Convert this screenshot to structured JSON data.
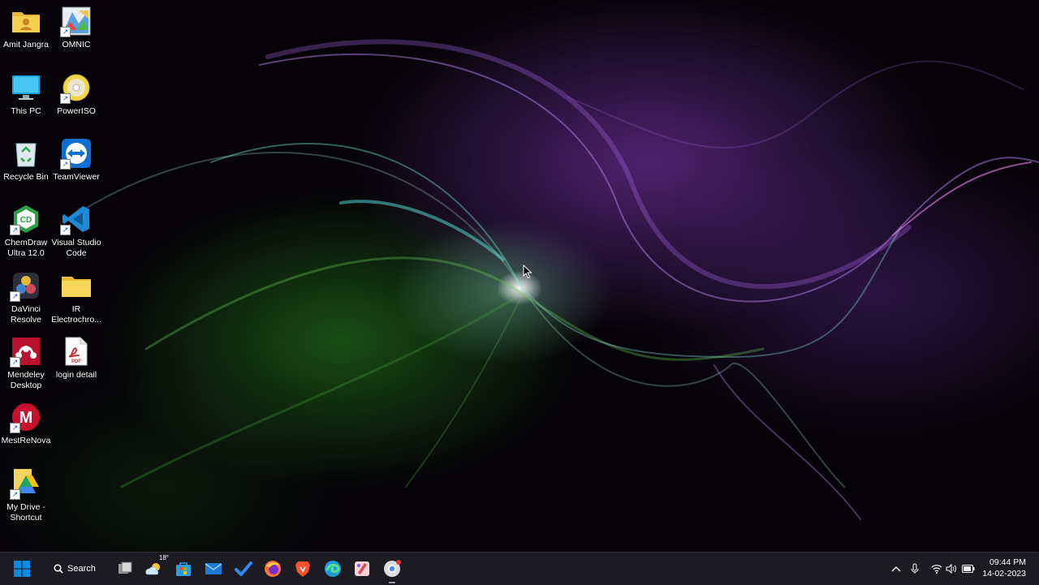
{
  "desktop": {
    "icons": [
      {
        "label": "Amit Jangra",
        "icon": "user-folder-icon"
      },
      {
        "label": "OMNIC",
        "icon": "omnic-app-icon"
      },
      {
        "label": "This PC",
        "icon": "monitor-icon"
      },
      {
        "label": "PowerISO",
        "icon": "poweriso-disc-icon"
      },
      {
        "label": "Recycle Bin",
        "icon": "recycle-bin-icon"
      },
      {
        "label": "TeamViewer",
        "icon": "teamviewer-icon"
      },
      {
        "label": "ChemDraw Ultra 12.0",
        "icon": "chemdraw-icon"
      },
      {
        "label": "Visual Studio Code",
        "icon": "vscode-icon"
      },
      {
        "label": "DaVinci Resolve",
        "icon": "davinci-resolve-icon"
      },
      {
        "label": "IR Electrochro...",
        "icon": "folder-icon"
      },
      {
        "label": "Mendeley Desktop",
        "icon": "mendeley-icon"
      },
      {
        "label": "login detail",
        "icon": "pdf-file-icon"
      },
      {
        "label": "MestReNova",
        "icon": "mestrenova-icon"
      },
      {
        "label": "My Drive - Shortcut",
        "icon": "google-drive-icon"
      }
    ]
  },
  "taskbar": {
    "search_label": "Search",
    "weather_temp": "18°",
    "apps": [
      "task-view",
      "weather",
      "microsoft-store",
      "mail",
      "todo",
      "firefox",
      "brave",
      "edge",
      "paint",
      "chrome"
    ],
    "tray": {
      "time": "09:44 PM",
      "date": "14-02-2023"
    }
  },
  "colors": {
    "taskbar_bg": "#1d1b22",
    "accent_blue": "#0078d4"
  }
}
